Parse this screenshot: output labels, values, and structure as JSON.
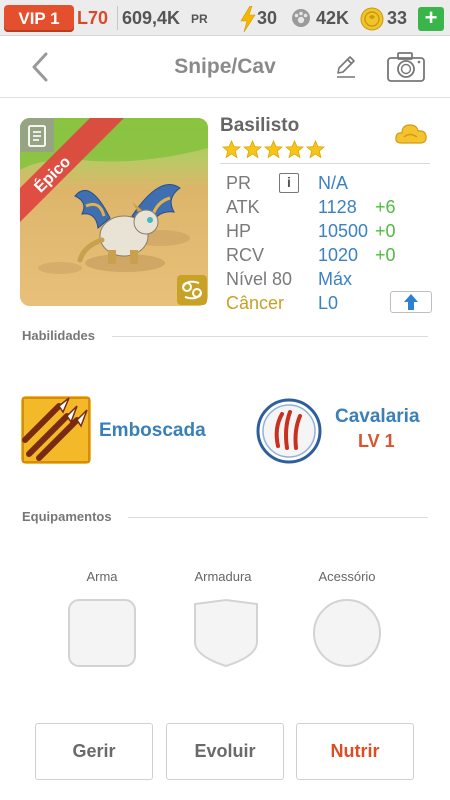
{
  "status_bar": {
    "vip": "VIP 1",
    "level": "L70",
    "power_value": "609,4K",
    "power_unit": "PR",
    "energy": "30",
    "food": "42K",
    "gold": "33",
    "add_label": "+"
  },
  "header": {
    "title": "Snipe/Cav"
  },
  "monster": {
    "rarity": "Épico",
    "name": "Basilisto",
    "stars": 5,
    "stats": {
      "pr_label": "PR",
      "pr_info": "i",
      "pr_value": "N/A",
      "atk_label": "ATK",
      "atk_value": "1128",
      "atk_bonus": "+6",
      "hp_label": "HP",
      "hp_value": "10500",
      "hp_bonus": "+0",
      "rcv_label": "RCV",
      "rcv_value": "1020",
      "rcv_bonus": "+0",
      "level_label": "Nível 80",
      "level_value": "Máx",
      "zodiac_label": "Câncer",
      "zodiac_value": "L0"
    }
  },
  "skills": {
    "section_title": "Habilidades",
    "skill_name": "Emboscada",
    "trait_name": "Cavalaria",
    "trait_level": "LV 1"
  },
  "equipment": {
    "section_title": "Equipamentos",
    "weapon_label": "Arma",
    "armor_label": "Armadura",
    "accessory_label": "Acessório"
  },
  "actions": {
    "manage": "Gerir",
    "evolve": "Evoluir",
    "feed": "Nutrir"
  },
  "colors": {
    "accent_blue": "#3a82c4",
    "bonus_green": "#4fbb3f",
    "primary_orange": "#dd4d24",
    "vip_red": "#e4502e",
    "rarity_red": "#e0443f"
  }
}
